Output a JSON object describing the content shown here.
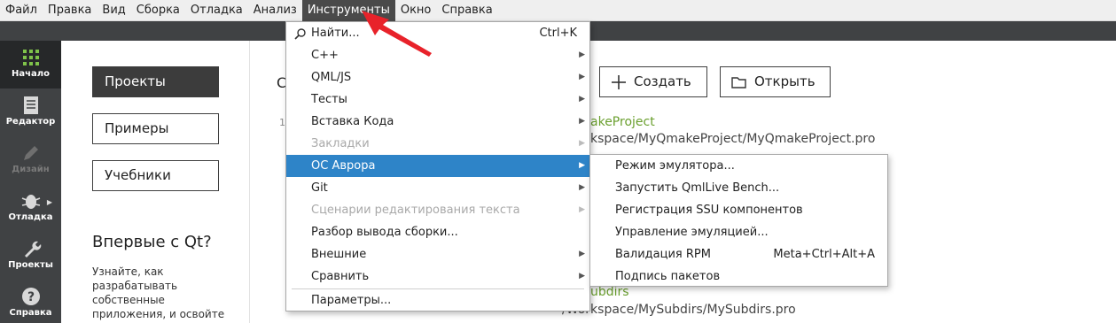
{
  "menubar": {
    "items": [
      {
        "label": "Файл"
      },
      {
        "label": "Правка"
      },
      {
        "label": "Вид"
      },
      {
        "label": "Сборка"
      },
      {
        "label": "Отладка"
      },
      {
        "label": "Анализ"
      },
      {
        "label": "Инструменты",
        "active": true
      },
      {
        "label": "Окно"
      },
      {
        "label": "Справка"
      }
    ]
  },
  "sidebar": {
    "modes": [
      {
        "label": "Начало",
        "icon": "grid-icon",
        "active": true
      },
      {
        "label": "Редактор",
        "icon": "document-icon"
      },
      {
        "label": "Дизайн",
        "icon": "pencil-icon",
        "disabled": true
      },
      {
        "label": "Отладка",
        "icon": "bug-icon"
      },
      {
        "label": "Проекты",
        "icon": "wrench-icon"
      },
      {
        "label": "Справка",
        "icon": "help-icon"
      }
    ]
  },
  "welcome": {
    "nav": [
      {
        "label": "Проекты",
        "active": true
      },
      {
        "label": "Примеры"
      },
      {
        "label": "Учебники"
      }
    ],
    "first_title": "Впервые с Qt?",
    "first_text": "Узнайте, как разрабатывать собственные приложения, и освойте"
  },
  "main": {
    "title_partial": "С",
    "create_label": "Создать",
    "open_label": "Открыть",
    "recent_num": "1",
    "projects": [
      {
        "name": "akeProject",
        "path": "kspace/MyQmakeProject/MyQmakeProject.pro"
      },
      {
        "name": "ubdirs",
        "path": "/Workspace/MySubdirs/MySubdirs.pro"
      }
    ]
  },
  "tools_menu": {
    "items": [
      {
        "label": "Найти...",
        "shortcut": "Ctrl+K",
        "icon": "search-icon"
      },
      {
        "label": "C++",
        "submenu": true
      },
      {
        "label": "QML/JS",
        "submenu": true
      },
      {
        "label": "Тесты",
        "submenu": true
      },
      {
        "label": "Вставка Кода",
        "submenu": true
      },
      {
        "label": "Закладки",
        "submenu": true,
        "disabled": true
      },
      {
        "label": "ОС Аврора",
        "submenu": true,
        "highlight": true
      },
      {
        "label": "Git",
        "submenu": true
      },
      {
        "label": "Сценарии редактирования текста",
        "submenu": true,
        "disabled": true
      },
      {
        "label": "Разбор вывода сборки..."
      },
      {
        "label": "Внешние",
        "submenu": true
      },
      {
        "label": "Сравнить",
        "submenu": true
      },
      {
        "label": "Параметры..."
      }
    ]
  },
  "aurora_submenu": {
    "items": [
      {
        "label": "Режим эмулятора..."
      },
      {
        "label": "Запустить QmlLive Bench..."
      },
      {
        "label": "Регистрация SSU компонентов"
      },
      {
        "label": "Управление эмуляцией..."
      },
      {
        "label": "Валидация RPM",
        "shortcut": "Meta+Ctrl+Alt+A"
      },
      {
        "label": "Подпись пакетов"
      }
    ]
  },
  "colors": {
    "highlight": "#2e84c8",
    "sidebar": "#404244",
    "annotation": "#e8222a",
    "project_link": "#6a9f2e"
  }
}
